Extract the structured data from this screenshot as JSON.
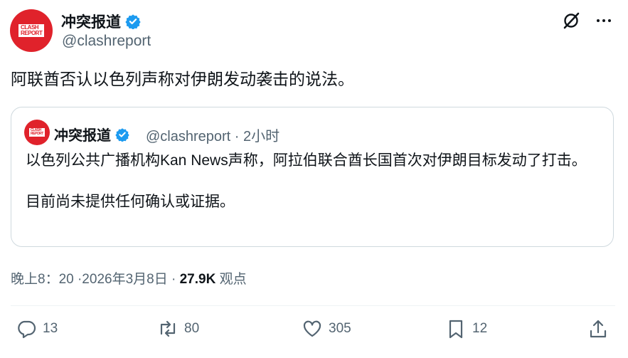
{
  "author": {
    "name": "冲突报道",
    "handle": "@clashreport",
    "logo_line1": "CLASH",
    "logo_line2": "REPORT"
  },
  "tweet_text": "阿联酋否认以色列声称对伊朗发动袭击的说法。",
  "quoted": {
    "name": "冲突报道",
    "meta": "@clashreport · 2小时",
    "body_line1": "以色列公共广播机构Kan News声称，阿拉伯联合酋长国首次对伊朗目标发动了打击。",
    "body_line2": "目前尚未提供任何确认或证据。"
  },
  "meta": {
    "time_date": "晚上8：20 ·2026年3月8日 · ",
    "views_count": "27.9K",
    "views_label": " 观点"
  },
  "actions": {
    "replies": "13",
    "reposts": "80",
    "likes": "305",
    "bookmarks": "12"
  },
  "colors": {
    "brand_red": "#e0222b",
    "verified_blue": "#1d9bf0",
    "secondary_text": "#536471",
    "border": "#cfd9de"
  },
  "icons": [
    "verified-badge-icon",
    "grok-icon",
    "more-icon",
    "reply-icon",
    "repost-icon",
    "like-icon",
    "bookmark-icon",
    "share-icon"
  ]
}
